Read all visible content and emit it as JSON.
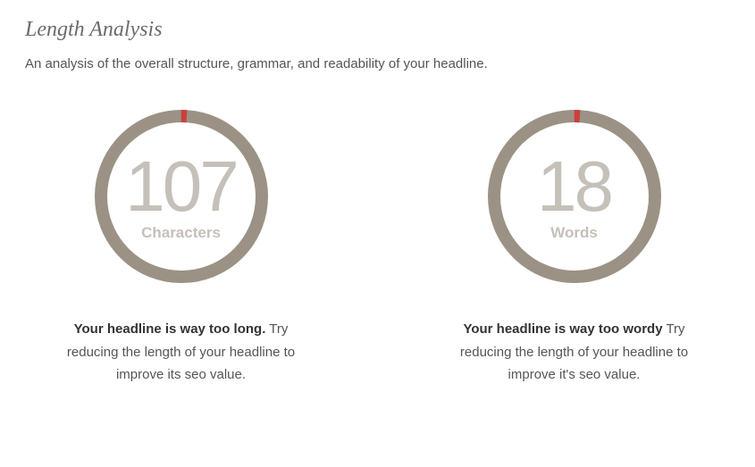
{
  "section": {
    "title": "Length Analysis",
    "subtitle": "An analysis of the overall structure, grammar, and readability of your headline."
  },
  "gauges": {
    "characters": {
      "value": "107",
      "unit": "Characters",
      "message_bold": "Your headline is way too long.",
      "message_rest": " Try reducing the length of your headline to improve its seo value."
    },
    "words": {
      "value": "18",
      "unit": "Words",
      "message_bold": "Your headline is way too wordy",
      "message_rest": " Try reducing the length of your headline to improve it's seo value."
    }
  },
  "colors": {
    "ring": "#9b9285",
    "indicator": "#cd3e3e"
  }
}
